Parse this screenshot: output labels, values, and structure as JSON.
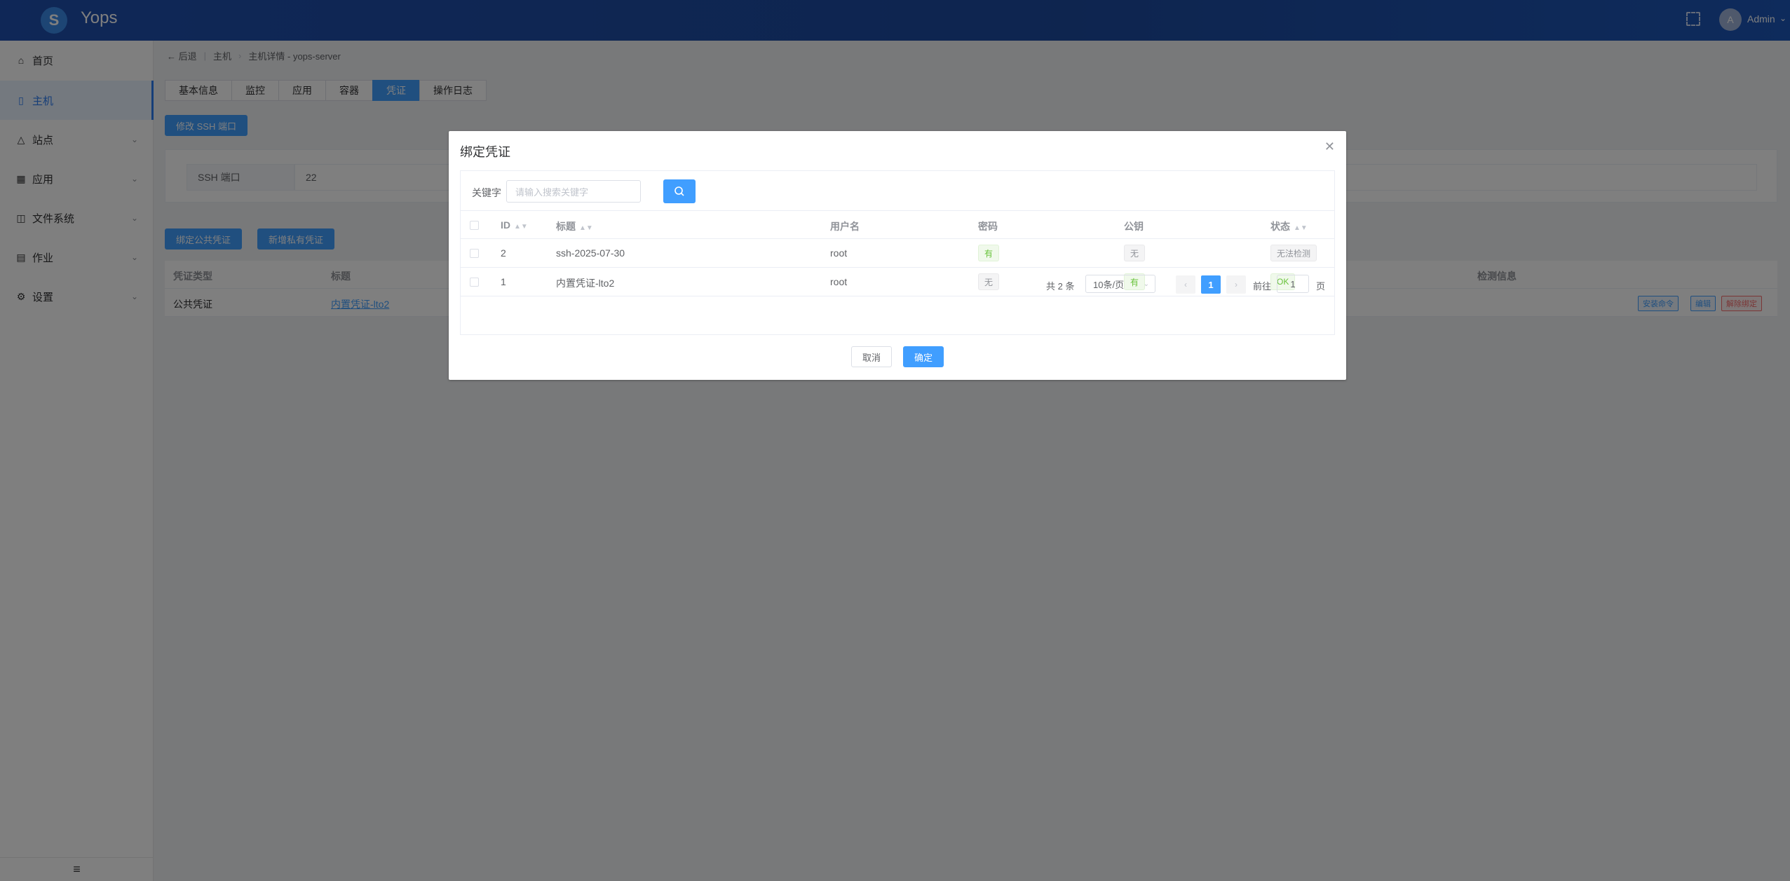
{
  "header": {
    "brand": "Yops",
    "logo_glyph": "S",
    "user_avatar": "A",
    "user_name": "Admin"
  },
  "sidebar": {
    "items": [
      {
        "label": "首页",
        "icon": "home-icon"
      },
      {
        "label": "主机",
        "icon": "server-icon"
      },
      {
        "label": "站点",
        "icon": "site-icon"
      },
      {
        "label": "应用",
        "icon": "apps-icon"
      },
      {
        "label": "文件系统",
        "icon": "filesystem-icon"
      },
      {
        "label": "作业",
        "icon": "job-icon"
      },
      {
        "label": "设置",
        "icon": "gear-icon"
      }
    ]
  },
  "breadcrumb": {
    "back": "后退",
    "host": "主机",
    "detail": "主机详情 - yops-server"
  },
  "tabs": [
    "基本信息",
    "监控",
    "应用",
    "容器",
    "凭证",
    "操作日志"
  ],
  "ssh": {
    "edit_button": "修改 SSH 端口",
    "label": "SSH 端口",
    "value": "22"
  },
  "credentials": {
    "bind_public_button": "绑定公共凭证",
    "add_private_button": "新增私有凭证",
    "headers": {
      "type": "凭证类型",
      "title": "标题",
      "check_info": "检测信息"
    },
    "rows": [
      {
        "type": "公共凭证",
        "title": "内置凭证-lto2",
        "actions": [
          "安装命令",
          "编辑",
          "解除绑定"
        ]
      }
    ]
  },
  "dialog": {
    "title": "绑定凭证",
    "keyword_label": "关键字",
    "keyword_placeholder": "请输入搜索关键字",
    "columns": {
      "id": "ID",
      "title": "标题",
      "username": "用户名",
      "password": "密码",
      "public_key": "公钥",
      "status": "状态"
    },
    "rows": [
      {
        "id": "2",
        "title": "ssh-2025-07-30",
        "username": "root",
        "password": "有",
        "public_key": "无",
        "status": "无法检测"
      },
      {
        "id": "1",
        "title": "内置凭证-lto2",
        "username": "root",
        "password": "无",
        "public_key": "有",
        "status": "OK"
      }
    ],
    "pagination": {
      "total": "共 2 条",
      "page_size": "10条/页",
      "current_page": "1",
      "goto_label": "前往",
      "goto_value": "1",
      "page_suffix": "页"
    },
    "cancel": "取消",
    "confirm": "确定"
  },
  "colors": {
    "primary": "#409eff",
    "header": "#1f4fae",
    "success": "#67c23a",
    "danger": "#f56c6c"
  }
}
